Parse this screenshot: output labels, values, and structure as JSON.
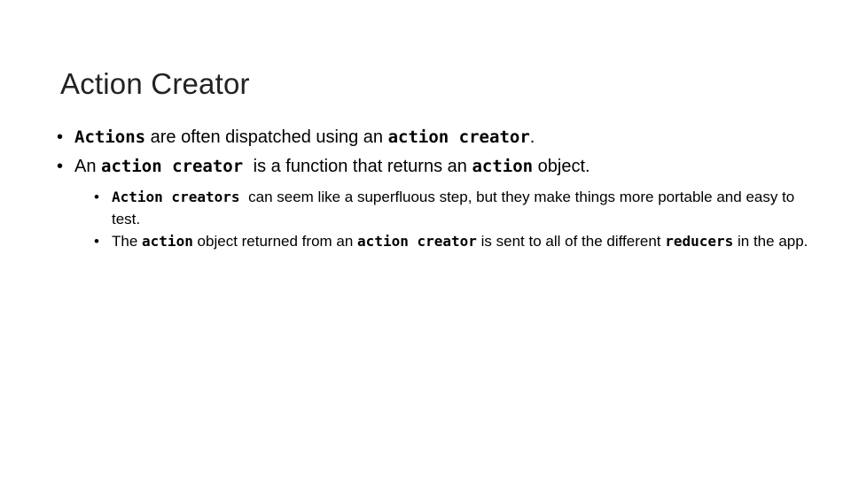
{
  "slide": {
    "title": "Action Creator",
    "bullet_char": "•",
    "level1": [
      {
        "parts": [
          {
            "text": "Actions",
            "mono": true
          },
          {
            "text": " are often dispatched using an ",
            "mono": false
          },
          {
            "text": "action creator",
            "mono": true
          },
          {
            "text": ".",
            "mono": false
          }
        ]
      },
      {
        "parts": [
          {
            "text": "An ",
            "mono": false
          },
          {
            "text": "action creator ",
            "mono": true
          },
          {
            "text": " is a function that returns an ",
            "mono": false
          },
          {
            "text": "action",
            "mono": true
          },
          {
            "text": " object.",
            "mono": false
          }
        ]
      }
    ],
    "level2": [
      {
        "parts": [
          {
            "text": "Action creators ",
            "mono": true
          },
          {
            "text": " can seem like a superfluous step, but they make things more portable and easy to test.",
            "mono": false
          }
        ]
      },
      {
        "parts": [
          {
            "text": "The ",
            "mono": false
          },
          {
            "text": "action",
            "mono": true
          },
          {
            "text": " object returned from an ",
            "mono": false
          },
          {
            "text": "action creator",
            "mono": true
          },
          {
            "text": " is sent to all of the different ",
            "mono": false
          },
          {
            "text": "reducers",
            "mono": true
          },
          {
            "text": " in the app.",
            "mono": false
          }
        ]
      }
    ]
  }
}
